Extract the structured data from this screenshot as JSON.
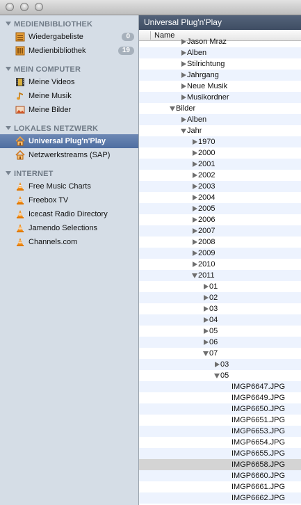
{
  "sidebar": {
    "sections": [
      {
        "title": "MEDIENBIBLIOTHEK",
        "items": [
          {
            "label": "Wiedergabeliste",
            "icon": "playlist-icon",
            "badge": "0"
          },
          {
            "label": "Medienbibliothek",
            "icon": "media-library-icon",
            "badge": "19"
          }
        ]
      },
      {
        "title": "MEIN COMPUTER",
        "items": [
          {
            "label": "Meine Videos",
            "icon": "film-icon"
          },
          {
            "label": "Meine Musik",
            "icon": "music-note-icon"
          },
          {
            "label": "Meine Bilder",
            "icon": "picture-icon"
          }
        ]
      },
      {
        "title": "LOKALES NETZWERK",
        "items": [
          {
            "label": "Universal Plug'n'Play",
            "icon": "network-home-icon",
            "selected": true
          },
          {
            "label": "Netzwerkstreams (SAP)",
            "icon": "network-home-icon"
          }
        ]
      },
      {
        "title": "INTERNET",
        "items": [
          {
            "label": "Free Music Charts",
            "icon": "vlc-cone-icon"
          },
          {
            "label": "Freebox TV",
            "icon": "vlc-cone-icon"
          },
          {
            "label": "Icecast Radio Directory",
            "icon": "vlc-cone-icon"
          },
          {
            "label": "Jamendo Selections",
            "icon": "vlc-cone-icon"
          },
          {
            "label": "Channels.com",
            "icon": "vlc-cone-icon"
          }
        ]
      }
    ]
  },
  "main": {
    "title": "Universal Plug'n'Play",
    "column_header": "Name",
    "selected_row": "IMGP6658.JPG",
    "rows": [
      {
        "label": "Jason Mraz",
        "depth": 2,
        "state": "collapsed"
      },
      {
        "label": "Alben",
        "depth": 2,
        "state": "collapsed"
      },
      {
        "label": "Stilrichtung",
        "depth": 2,
        "state": "collapsed"
      },
      {
        "label": "Jahrgang",
        "depth": 2,
        "state": "collapsed"
      },
      {
        "label": "Neue Musik",
        "depth": 2,
        "state": "collapsed"
      },
      {
        "label": "Musikordner",
        "depth": 2,
        "state": "collapsed"
      },
      {
        "label": "Bilder",
        "depth": 1,
        "state": "expanded"
      },
      {
        "label": "Alben",
        "depth": 2,
        "state": "collapsed"
      },
      {
        "label": "Jahr",
        "depth": 2,
        "state": "expanded"
      },
      {
        "label": "1970",
        "depth": 3,
        "state": "collapsed"
      },
      {
        "label": "2000",
        "depth": 3,
        "state": "collapsed"
      },
      {
        "label": "2001",
        "depth": 3,
        "state": "collapsed"
      },
      {
        "label": "2002",
        "depth": 3,
        "state": "collapsed"
      },
      {
        "label": "2003",
        "depth": 3,
        "state": "collapsed"
      },
      {
        "label": "2004",
        "depth": 3,
        "state": "collapsed"
      },
      {
        "label": "2005",
        "depth": 3,
        "state": "collapsed"
      },
      {
        "label": "2006",
        "depth": 3,
        "state": "collapsed"
      },
      {
        "label": "2007",
        "depth": 3,
        "state": "collapsed"
      },
      {
        "label": "2008",
        "depth": 3,
        "state": "collapsed"
      },
      {
        "label": "2009",
        "depth": 3,
        "state": "collapsed"
      },
      {
        "label": "2010",
        "depth": 3,
        "state": "collapsed"
      },
      {
        "label": "2011",
        "depth": 3,
        "state": "expanded"
      },
      {
        "label": "01",
        "depth": 4,
        "state": "collapsed"
      },
      {
        "label": "02",
        "depth": 4,
        "state": "collapsed"
      },
      {
        "label": "03",
        "depth": 4,
        "state": "collapsed"
      },
      {
        "label": "04",
        "depth": 4,
        "state": "collapsed"
      },
      {
        "label": "05",
        "depth": 4,
        "state": "collapsed"
      },
      {
        "label": "06",
        "depth": 4,
        "state": "collapsed"
      },
      {
        "label": "07",
        "depth": 4,
        "state": "expanded"
      },
      {
        "label": "03",
        "depth": 5,
        "state": "collapsed"
      },
      {
        "label": "05",
        "depth": 5,
        "state": "expanded"
      },
      {
        "label": "IMGP6647.JPG",
        "depth": 6,
        "state": "leaf"
      },
      {
        "label": "IMGP6649.JPG",
        "depth": 6,
        "state": "leaf"
      },
      {
        "label": "IMGP6650.JPG",
        "depth": 6,
        "state": "leaf"
      },
      {
        "label": "IMGP6651.JPG",
        "depth": 6,
        "state": "leaf"
      },
      {
        "label": "IMGP6653.JPG",
        "depth": 6,
        "state": "leaf"
      },
      {
        "label": "IMGP6654.JPG",
        "depth": 6,
        "state": "leaf"
      },
      {
        "label": "IMGP6655.JPG",
        "depth": 6,
        "state": "leaf"
      },
      {
        "label": "IMGP6658.JPG",
        "depth": 6,
        "state": "leaf"
      },
      {
        "label": "IMGP6660.JPG",
        "depth": 6,
        "state": "leaf"
      },
      {
        "label": "IMGP6661.JPG",
        "depth": 6,
        "state": "leaf"
      },
      {
        "label": "IMGP6662.JPG",
        "depth": 6,
        "state": "leaf"
      }
    ]
  },
  "colors": {
    "sidebar_bg": "#d5dde6",
    "selection": "#5a78aa",
    "panel_header": "#4a586e",
    "row_stripe": "#edf3fe",
    "row_selected": "#d4d4d4"
  }
}
